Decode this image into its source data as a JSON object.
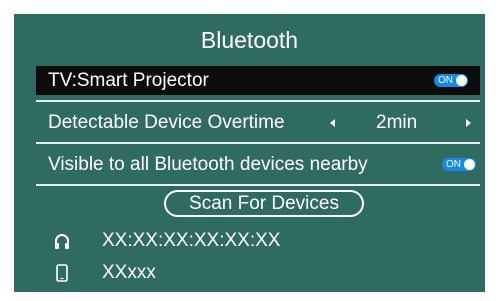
{
  "title": "Bluetooth",
  "rows": [
    {
      "label": "TV:Smart Projector",
      "toggle": "ON"
    },
    {
      "label": "Detectable Device Overtime",
      "value": "2min"
    },
    {
      "label": "Visible to all Bluetooth devices nearby",
      "toggle": "ON"
    }
  ],
  "scan_button": "Scan For Devices",
  "devices": [
    {
      "icon": "headphones-icon",
      "name": "XX:XX:XX:XX:XX:XX"
    },
    {
      "icon": "phone-icon",
      "name": "XXxxx"
    }
  ],
  "colors": {
    "panel": "#2f6b61",
    "toggle_on": "#1689e8",
    "selected_row": "#0c0c0c"
  }
}
